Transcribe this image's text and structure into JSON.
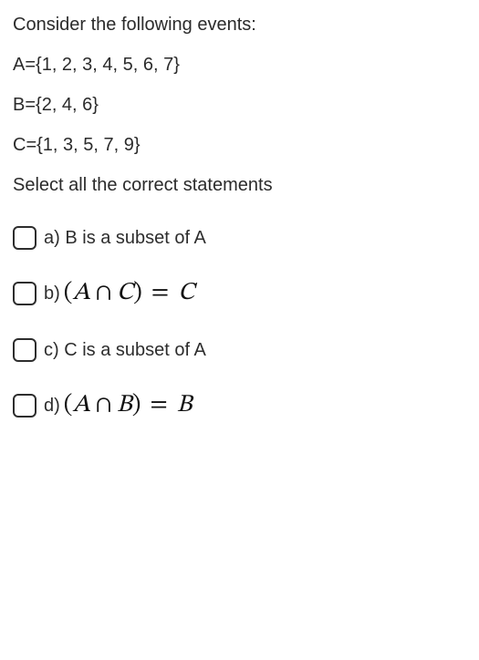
{
  "prompt": {
    "intro": "Consider the following events:",
    "setA": "A={1, 2, 3, 4, 5, 6, 7}",
    "setB": "B={2, 4, 6}",
    "setC": "C={1, 3, 5, 7, 9}",
    "instruction": "Select all the correct statements"
  },
  "options": {
    "a": {
      "prefix": "a)",
      "text": "B is a subset of A"
    },
    "b": {
      "prefix": "b)",
      "math": {
        "lp": "(",
        "A": "A",
        "cap": "∩",
        "C": "C",
        "rp": ")",
        "eq": "=",
        "rhs": "C"
      }
    },
    "c": {
      "prefix": "c)",
      "text": "C is a subset of A"
    },
    "d": {
      "prefix": "d)",
      "math": {
        "lp": "(",
        "A": "A",
        "cap": "∩",
        "B": "B",
        "rp": ")",
        "eq": "=",
        "rhs": "B"
      }
    }
  }
}
